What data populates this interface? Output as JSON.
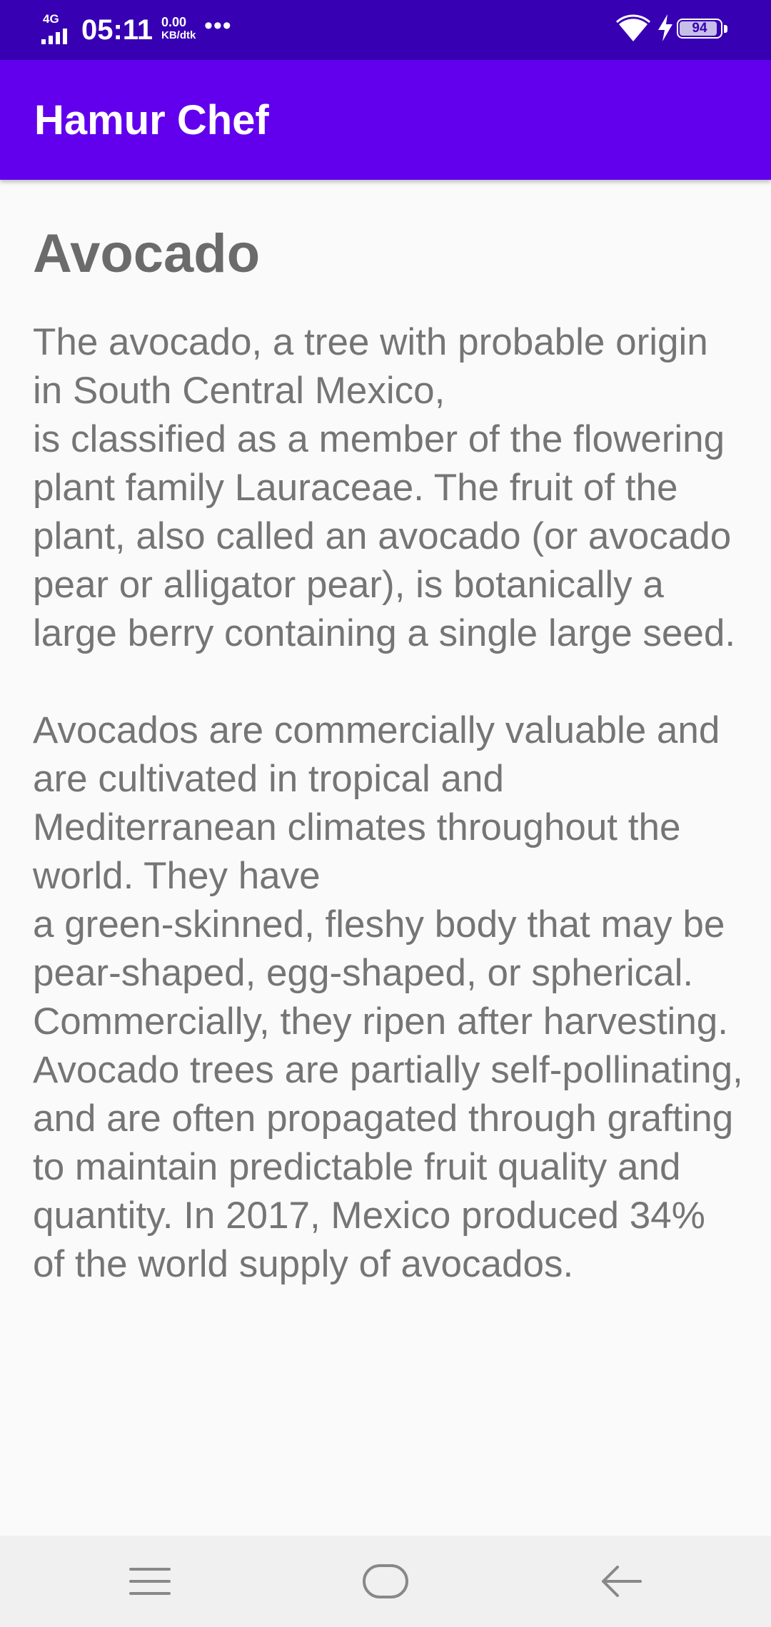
{
  "status_bar": {
    "network_type": "4G",
    "time": "05:11",
    "net_speed_value": "0.00",
    "net_speed_unit": "KB/dtk",
    "more_indicator": "•••",
    "battery_level": "94",
    "icons": [
      "signal-icon",
      "wifi-icon",
      "charging-icon",
      "battery-icon"
    ],
    "color": "#3700b3"
  },
  "app_bar": {
    "title": "Hamur Chef",
    "color": "#6200ee"
  },
  "content": {
    "title": "Avocado",
    "description": "The avocado, a tree with probable origin in South Central Mexico,\nis classified as a member of the flowering plant family Lauraceae. The fruit of the plant, also called an avocado (or avocado pear or alligator pear), is botanically a large berry containing a single large seed.\n\nAvocados are commercially valuable and are cultivated in tropical and Mediterranean climates throughout the world. They have\na green-skinned, fleshy body that may be pear-shaped, egg-shaped, or spherical. Commercially, they ripen after harvesting. Avocado trees are partially self-pollinating, and are often propagated through grafting to maintain predictable fruit quality and quantity. In 2017, Mexico produced 34% of the world supply of avocados."
  },
  "nav_bar": {
    "buttons": [
      "menu-icon",
      "home-icon",
      "back-icon"
    ]
  }
}
